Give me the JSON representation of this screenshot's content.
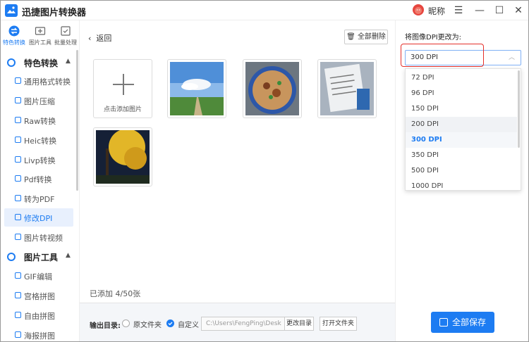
{
  "app": {
    "title": "迅捷图片转换器",
    "nickname": "昵称"
  },
  "window_controls": {
    "menu": "☰",
    "minimize": "—",
    "maximize": "☐",
    "close": "✕"
  },
  "side_tabs": [
    {
      "label": "特色转换",
      "icon": "swap-icon",
      "active": true
    },
    {
      "label": "图片工具",
      "icon": "image-tool-icon",
      "active": false
    },
    {
      "label": "批量处理",
      "icon": "batch-icon",
      "active": false
    }
  ],
  "sidebar": {
    "sections": [
      {
        "title": "特色转换",
        "expanded": true,
        "items": [
          "通用格式转换",
          "图片压缩",
          "Raw转换",
          "Heic转换",
          "Livp转换",
          "Pdf转换",
          "转为PDF",
          "修改DPI",
          "图片转视频"
        ]
      },
      {
        "title": "图片工具",
        "expanded": true,
        "items": [
          "GIF编辑",
          "宫格拼图",
          "自由拼图",
          "海报拼图"
        ]
      }
    ],
    "active_item": "修改DPI"
  },
  "main": {
    "back_label": "返回",
    "delete_all_label": "全部删除",
    "add_tile_label": "点击添加图片",
    "images": [
      {
        "name": "sky-field-photo"
      },
      {
        "name": "noodle-bowl-photo"
      },
      {
        "name": "document-photo"
      },
      {
        "name": "yellow-tree-night-photo"
      }
    ],
    "count_text": "已添加 4/50张"
  },
  "footer": {
    "output_label": "输出目录:",
    "option_original": "原文件夹",
    "option_custom": "自定义",
    "selected_option": "自定义",
    "path_value": "C:\\Users\\FengPing\\Desk",
    "change_dir_label": "更改目录",
    "open_folder_label": "打开文件夹"
  },
  "dpi_panel": {
    "title": "将图像DPI更改为:",
    "selected": "300 DPI",
    "options": [
      "72 DPI",
      "96 DPI",
      "150 DPI",
      "200 DPI",
      "300 DPI",
      "350 DPI",
      "500 DPI",
      "1000 DPI"
    ],
    "hovered": "200 DPI"
  },
  "save_label": "全部保存",
  "colors": {
    "accent": "#1d7cf2",
    "highlight": "#e5302a"
  }
}
